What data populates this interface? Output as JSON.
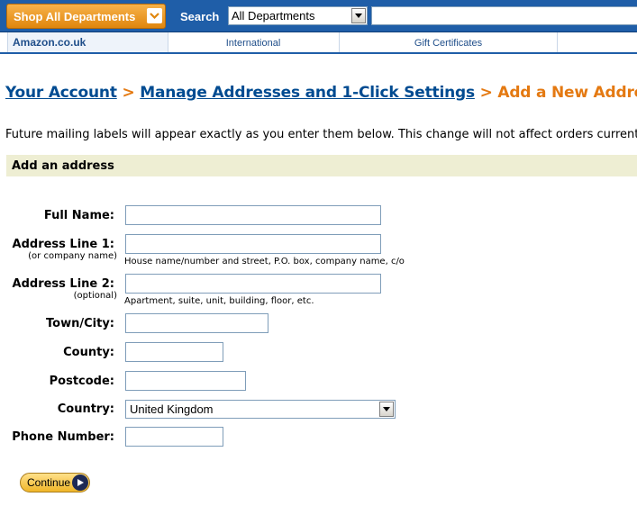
{
  "header": {
    "shop_all_label": "Shop All Departments",
    "search_label": "Search",
    "department_select": "All Departments",
    "search_value": ""
  },
  "nav": {
    "home": "Amazon.co.uk",
    "links": [
      "International",
      "Gift Certificates"
    ]
  },
  "breadcrumb": {
    "items": [
      "Your Account",
      "Manage Addresses and 1-Click Settings"
    ],
    "separator": ">",
    "current": "Add a New Address"
  },
  "intro": "Future mailing labels will appear exactly as you enter them below. This change will not affect orders currently in progress.",
  "section_title": "Add an address",
  "form": {
    "full_name": {
      "label": "Full Name:",
      "value": ""
    },
    "address1": {
      "label": "Address Line 1:",
      "sub": "(or company name)",
      "hint": "House name/number and street, P.O. box, company name, c/o",
      "value": ""
    },
    "address2": {
      "label": "Address Line 2:",
      "sub": "(optional)",
      "hint": "Apartment, suite, unit, building, floor, etc.",
      "value": ""
    },
    "town": {
      "label": "Town/City:",
      "value": ""
    },
    "county": {
      "label": "County:",
      "value": ""
    },
    "postcode": {
      "label": "Postcode:",
      "value": ""
    },
    "country": {
      "label": "Country:",
      "value": "United Kingdom"
    },
    "phone": {
      "label": "Phone Number:",
      "value": ""
    },
    "continue_label": "Continue"
  },
  "colors": {
    "link": "#004b91",
    "accent_orange": "#e47911",
    "header_blue": "#1f5ea8",
    "section_bg": "#eeeed3"
  }
}
